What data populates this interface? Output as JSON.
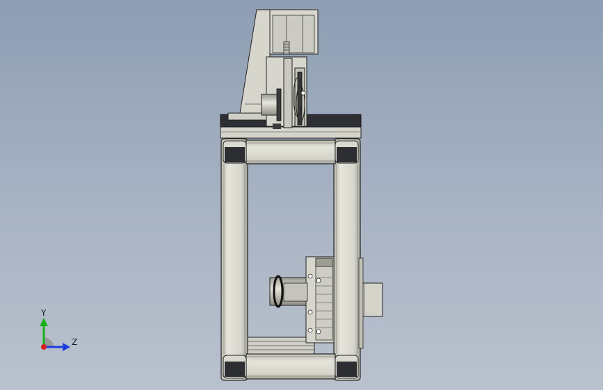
{
  "viewport": {
    "background_top": "#8e9db3",
    "background_bottom": "#b9c1cd",
    "part_color": "#d9d9cf",
    "edge_color": "#222222"
  },
  "triad": {
    "y_label": "Y",
    "z_label": "Z",
    "y_color": "#1bb01b",
    "z_color": "#1e3cd8",
    "origin_color": "#d42020"
  }
}
